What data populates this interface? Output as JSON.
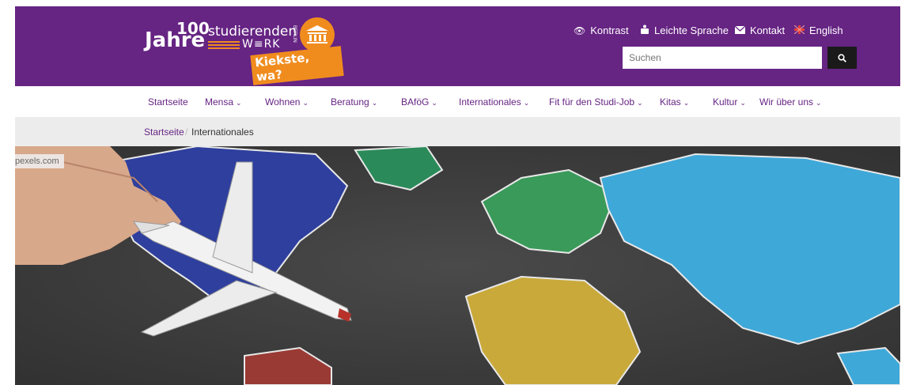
{
  "logo": {
    "number": "100",
    "jahre": "Jahre",
    "studierenden": "studierenden",
    "werk": "W≡RK",
    "berlin": "BERLIN",
    "slogan": "Kiekste, wa?"
  },
  "util": {
    "contrast": "Kontrast",
    "easy_language": "Leichte Sprache",
    "contact": "Kontakt",
    "english": "English"
  },
  "search": {
    "placeholder": "Suchen"
  },
  "nav": {
    "items": [
      {
        "label": "Startseite",
        "chev": ""
      },
      {
        "label": "Mensa",
        "chev": "❯"
      },
      {
        "label": "Wohnen",
        "chev": "❯"
      },
      {
        "label": "Beratung",
        "chev": "❯"
      },
      {
        "label": "BAföG",
        "chev": "❯"
      },
      {
        "label": "Internationales",
        "chev": "❯"
      },
      {
        "label": "Fit für den Studi-Job",
        "chev": "❯"
      },
      {
        "label": "Kitas",
        "chev": "❯"
      },
      {
        "label": "Kultur",
        "chev": "❯"
      },
      {
        "label": "Wir über uns",
        "chev": "❯"
      }
    ]
  },
  "breadcrumb": {
    "home": "Startseite",
    "separator": "/",
    "current": "Internationales"
  },
  "hero": {
    "credit": "pexels.com"
  },
  "colors": {
    "brand": "#662483",
    "accent": "#f08c1e"
  }
}
